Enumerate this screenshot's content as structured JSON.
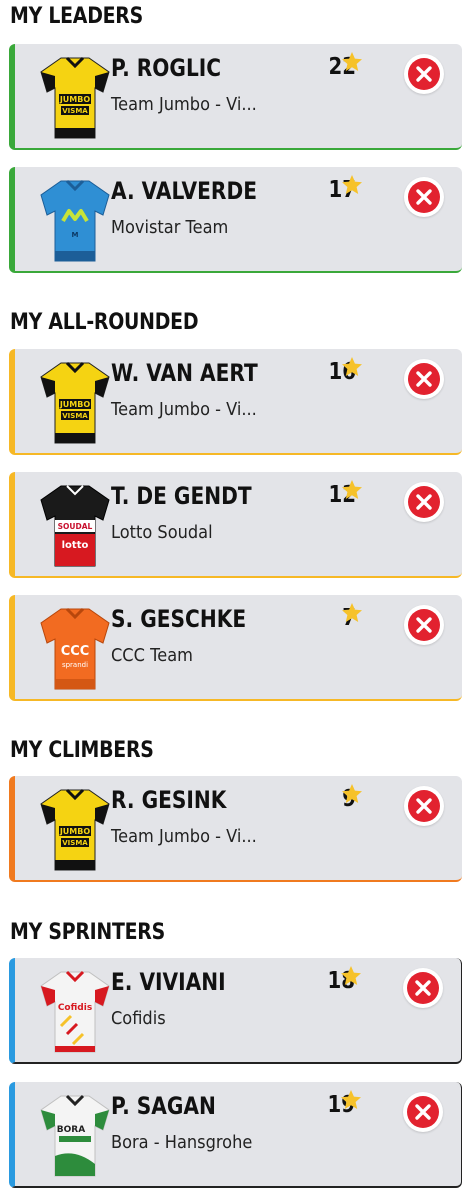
{
  "colors": {
    "leader": "#3aa83a",
    "allround": "#f6b826",
    "climber": "#f07a1f",
    "sprinter": "#2a9ae0",
    "remove_red": "#e2222f",
    "star": "#f6c22a"
  },
  "sections": [
    {
      "title": "MY LEADERS",
      "riders": [
        {
          "name": "P. ROGLIC",
          "team": "Team Jumbo - Vi...",
          "points": "22",
          "jersey": "jumbo-visma"
        },
        {
          "name": "A. VALVERDE",
          "team": "Movistar Team",
          "points": "17",
          "jersey": "movistar"
        }
      ]
    },
    {
      "title": "MY ALL-ROUNDED",
      "riders": [
        {
          "name": "W. VAN AERT",
          "team": "Team Jumbo - Vi...",
          "points": "16",
          "jersey": "jumbo-visma"
        },
        {
          "name": "T. DE GENDT",
          "team": "Lotto Soudal",
          "points": "12",
          "jersey": "lotto-soudal"
        },
        {
          "name": "S. GESCHKE",
          "team": "CCC Team",
          "points": "7",
          "jersey": "ccc"
        }
      ]
    },
    {
      "title": "MY CLIMBERS",
      "riders": [
        {
          "name": "R. GESINK",
          "team": "Team Jumbo - Vi...",
          "points": "9",
          "jersey": "jumbo-visma"
        }
      ]
    },
    {
      "title": "MY SPRINTERS",
      "riders": [
        {
          "name": "E. VIVIANI",
          "team": "Cofidis",
          "points": "18",
          "jersey": "cofidis"
        },
        {
          "name": "P. SAGAN",
          "team": "Bora - Hansgrohe",
          "points": "19",
          "jersey": "bora-hansgrohe"
        }
      ]
    }
  ],
  "jersey_text": {
    "jumbo_top": "JUMBO",
    "jumbo_bottom": "VISMA",
    "movistar": "M",
    "soudal": "SOUDAL",
    "lotto": "lotto",
    "ccc": "CCC",
    "sprandi": "sprandi",
    "cofidis": "Cofidis",
    "bora": "BORA"
  }
}
